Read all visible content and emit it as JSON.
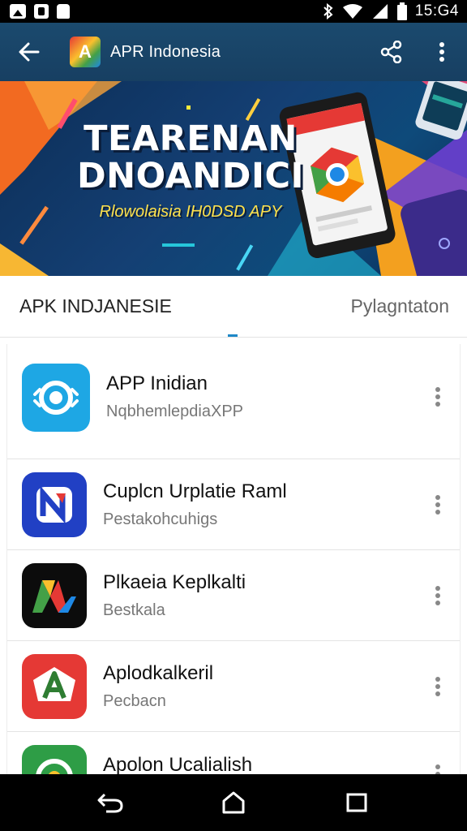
{
  "status_bar": {
    "time": "15:G4",
    "left_icons": [
      "image-notification-icon",
      "file-notification-icon",
      "bag-notification-icon"
    ],
    "right_icons": [
      "bluetooth-icon",
      "wifi-icon",
      "signal-icon",
      "battery-icon"
    ]
  },
  "app_bar": {
    "title": "APR Indonesia",
    "back_icon": "arrow-left-icon",
    "share_icon": "share-icon",
    "menu_icon": "more-vert-icon",
    "logo_letter": "A",
    "background": "#1b4a6e"
  },
  "banner": {
    "headline_line1": "TEARENAN",
    "headline_line2": "DNOANDICI",
    "subtitle": "Rlowolaisia IH0DSD APY"
  },
  "tabs": [
    {
      "label": "APK INDJANESIE",
      "active": true
    },
    {
      "label": "Pylagntaton",
      "active": false
    }
  ],
  "accent": "#1e88c7",
  "apps": [
    {
      "name": "APP Inidian",
      "subtitle": "NqbhemlepdiaXPP",
      "icon": "refresh-circle-icon",
      "icon_bg": "#1ea7e4"
    },
    {
      "name": "Cuplcn Urplatie Raml",
      "subtitle": "Pestakohcuhigs",
      "icon": "n-letter-icon",
      "icon_bg": "#2140c4"
    },
    {
      "name": "Plkaeia Keplkalti",
      "subtitle": "Bestkala",
      "icon": "m-letter-icon",
      "icon_bg": "#0c0c0c"
    },
    {
      "name": "Aplodkalkeril",
      "subtitle": "Pecbacn",
      "icon": "a-letter-icon",
      "icon_bg": "#e53935"
    },
    {
      "name": "Apolon Ucalialish",
      "subtitle": "",
      "icon": "green-circle-icon",
      "icon_bg": "#2e9d46"
    }
  ],
  "nav_bar": {
    "back": "nav-back-icon",
    "home": "nav-home-icon",
    "recents": "nav-recents-icon"
  }
}
